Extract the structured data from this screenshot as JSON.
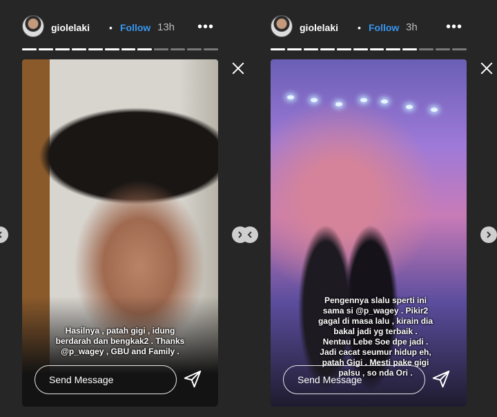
{
  "stories": [
    {
      "username": "giolelaki",
      "separator": "•",
      "follow_label": "Follow",
      "time": "13h",
      "more_label": "•••",
      "progress": {
        "total": 12,
        "viewed": 8
      },
      "caption_lines": [
        "Hasilnya , patah gigi , idung",
        "berdarah dan bengkak2 . Thanks",
        "@p_wagey , GBU and Family ."
      ],
      "send_placeholder": "Send Message"
    },
    {
      "username": "giolelaki",
      "separator": "•",
      "follow_label": "Follow",
      "time": "3h",
      "more_label": "•••",
      "progress": {
        "total": 12,
        "viewed": 9
      },
      "caption_lines": [
        "Pengennya slalu sperti ini",
        "sama si @p_wagey . Pikir2",
        "gagal di masa lalu , kirain dia",
        "bakal jadi yg terbaik .",
        "Nentau Lebe Soe dpe jadi .",
        "Jadi cacat seumur hidup eh,",
        "patah Gigi . Mesti pake gigi",
        "palsu , so nda Ori ."
      ],
      "send_placeholder": "Send Message"
    }
  ],
  "icons": {
    "more": "more-options-icon",
    "close": "close-icon",
    "send": "paper-plane-icon",
    "nav_prev": "chevron-left-icon",
    "nav_next": "chevron-right-icon"
  }
}
